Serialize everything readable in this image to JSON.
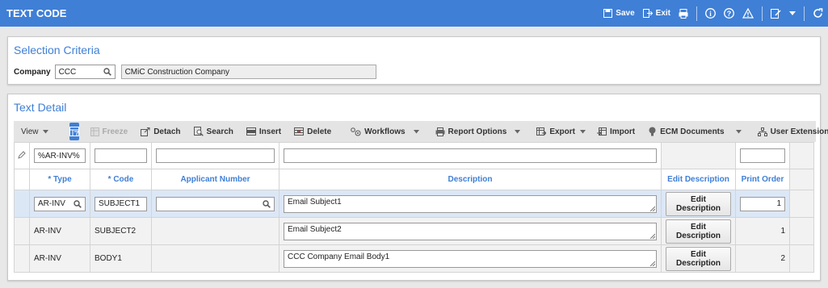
{
  "app": {
    "title": "TEXT CODE"
  },
  "titlebar": {
    "save_label": "Save",
    "exit_label": "Exit"
  },
  "selection": {
    "title": "Selection Criteria",
    "company_label": "Company",
    "company_value": "CCC",
    "company_name": "CMiC Construction Company"
  },
  "detail": {
    "title": "Text Detail",
    "toolbar": {
      "view": "View",
      "freeze": "Freeze",
      "detach": "Detach",
      "search": "Search",
      "insert": "Insert",
      "delete": "Delete",
      "workflows": "Workflows",
      "report_options": "Report Options",
      "export": "Export",
      "import": "Import",
      "ecm_documents": "ECM Documents",
      "user_extensions": "User Extensions"
    },
    "filter": {
      "type": "%AR-INV%",
      "code": "",
      "applicant": "",
      "description": "",
      "print_order": ""
    },
    "columns": {
      "type": "* Type",
      "code": "* Code",
      "applicant": "Applicant Number",
      "description": "Description",
      "edit_description": "Edit Description",
      "print_order": "Print Order"
    },
    "edit_button_label": "Edit Description",
    "rows": [
      {
        "type": "AR-INV",
        "code": "SUBJECT1",
        "applicant": "",
        "description": "Email Subject1",
        "print_order": "1"
      },
      {
        "type": "AR-INV",
        "code": "SUBJECT2",
        "applicant": "",
        "description": "Email Subject2",
        "print_order": "1"
      },
      {
        "type": "AR-INV",
        "code": "BODY1",
        "applicant": "",
        "description": "CCC Company Email Body1",
        "print_order": "2"
      }
    ]
  },
  "colors": {
    "brand": "#3f7fd6",
    "selected_row": "#dce7f6"
  }
}
